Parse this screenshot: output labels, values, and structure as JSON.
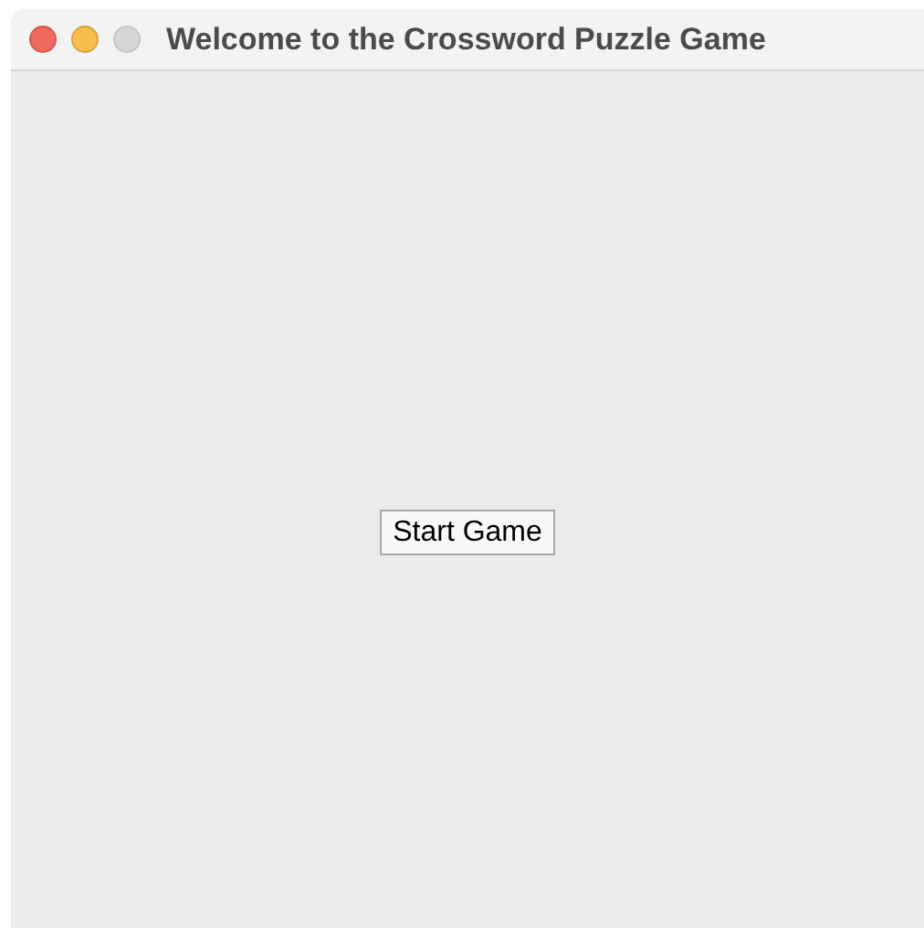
{
  "window": {
    "title": "Welcome to the Crossword Puzzle Game"
  },
  "button": {
    "label": "Start Game"
  }
}
